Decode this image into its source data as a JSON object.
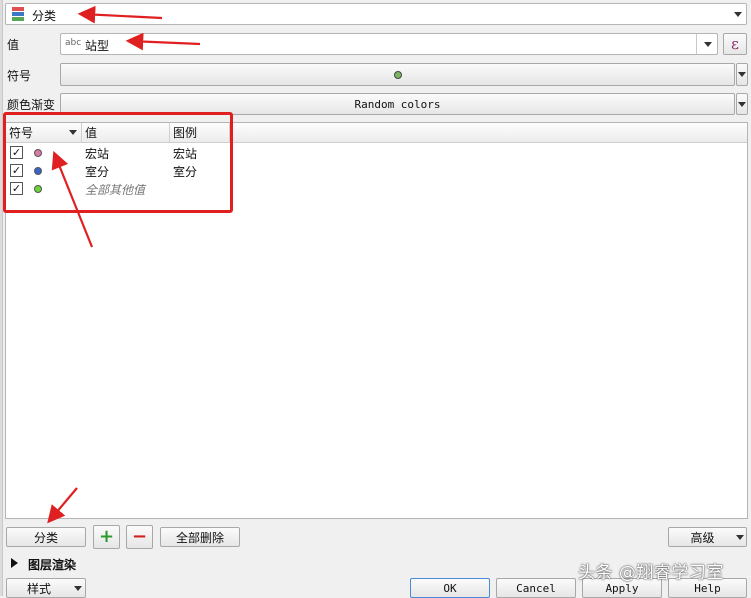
{
  "renderer": {
    "selected": "分类",
    "icon": "categorized-renderer-icon"
  },
  "value_field": {
    "label": "值",
    "type_tag": "abc",
    "value": "站型",
    "expr_button": "ε"
  },
  "symbol_row": {
    "label": "符号",
    "preview_color": "#7bb661"
  },
  "color_ramp": {
    "label": "颜色渐变",
    "value": "Random colors"
  },
  "table": {
    "headers": [
      "符号",
      "值",
      "图例"
    ],
    "rows": [
      {
        "checked": "✓",
        "color": "#d77aa6",
        "value": "宏站",
        "legend": "宏站",
        "italic": false
      },
      {
        "checked": "✓",
        "color": "#3c64c8",
        "value": "室分",
        "legend": "室分",
        "italic": false
      },
      {
        "checked": "✓",
        "color": "#6cd43a",
        "value": "全部其他值",
        "legend": "",
        "italic": true
      }
    ]
  },
  "buttons": {
    "classify": "分类",
    "add": "+",
    "remove": "−",
    "delete_all": "全部删除",
    "advanced": "高级"
  },
  "layer_rendering": "图层渲染",
  "footer": {
    "style": "样式",
    "ok": "OK",
    "cancel": "Cancel",
    "apply": "Apply",
    "help": "Help"
  },
  "watermark": "头条 @翔睿学习室",
  "colors": {
    "annotation": "#e02020",
    "accent_green": "#3a9a3a",
    "accent_red": "#d02020"
  }
}
